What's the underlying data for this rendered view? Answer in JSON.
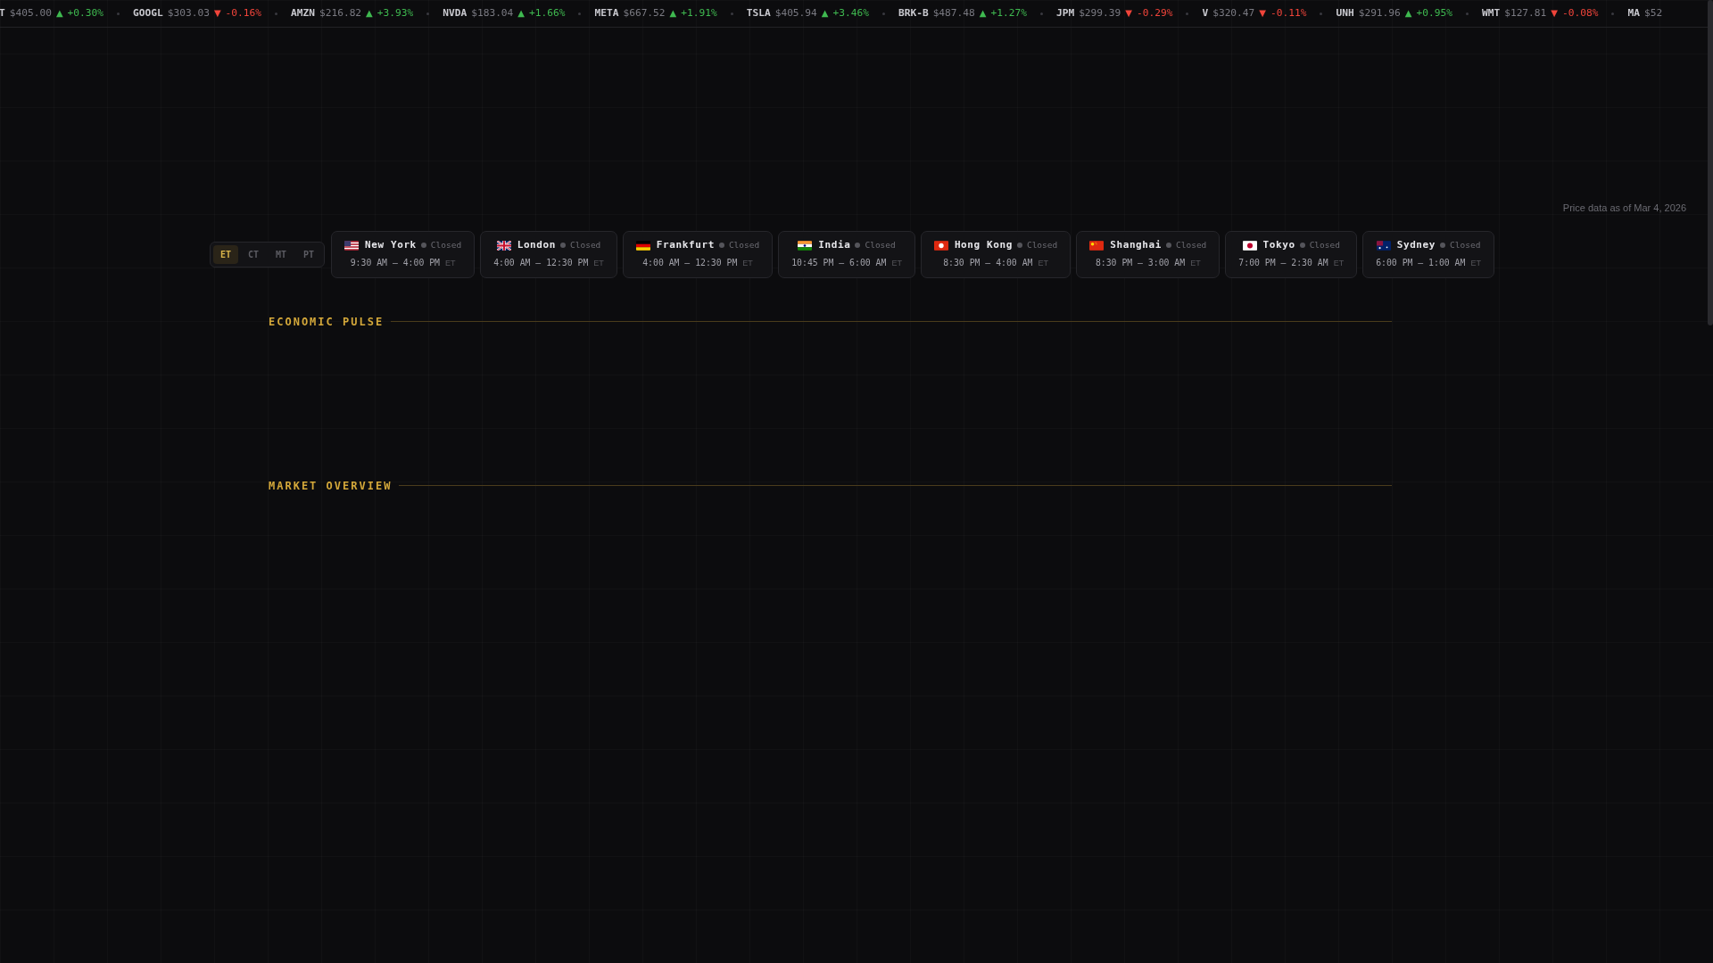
{
  "ticker": [
    {
      "symbol": "T",
      "price": "$405.00",
      "positive": true,
      "arrow": "▲",
      "change": "+0.30%"
    },
    {
      "symbol": "GOOGL",
      "price": "$303.03",
      "positive": false,
      "arrow": "▼",
      "change": "-0.16%"
    },
    {
      "symbol": "AMZN",
      "price": "$216.82",
      "positive": true,
      "arrow": "▲",
      "change": "+3.93%"
    },
    {
      "symbol": "NVDA",
      "price": "$183.04",
      "positive": true,
      "arrow": "▲",
      "change": "+1.66%"
    },
    {
      "symbol": "META",
      "price": "$667.52",
      "positive": true,
      "arrow": "▲",
      "change": "+1.91%"
    },
    {
      "symbol": "TSLA",
      "price": "$405.94",
      "positive": true,
      "arrow": "▲",
      "change": "+3.46%"
    },
    {
      "symbol": "BRK-B",
      "price": "$487.48",
      "positive": true,
      "arrow": "▲",
      "change": "+1.27%"
    },
    {
      "symbol": "JPM",
      "price": "$299.39",
      "positive": false,
      "arrow": "▼",
      "change": "-0.29%"
    },
    {
      "symbol": "V",
      "price": "$320.47",
      "positive": false,
      "arrow": "▼",
      "change": "-0.11%"
    },
    {
      "symbol": "UNH",
      "price": "$291.96",
      "positive": true,
      "arrow": "▲",
      "change": "+0.95%"
    },
    {
      "symbol": "WMT",
      "price": "$127.81",
      "positive": false,
      "arrow": "▼",
      "change": "-0.08%"
    },
    {
      "symbol": "MA",
      "price": "$52"
    }
  ],
  "price_note": "Price data as of Mar 4, 2026",
  "timezones": [
    {
      "label": "ET",
      "selected": true
    },
    {
      "label": "CT",
      "selected": false
    },
    {
      "label": "MT",
      "selected": false
    },
    {
      "label": "PT",
      "selected": false
    }
  ],
  "markets": [
    {
      "kind": "us",
      "name": "New York",
      "status": "Closed",
      "open": false,
      "hours": "9:30 AM – 4:00 PM",
      "tz": "ET"
    },
    {
      "kind": "gb",
      "name": "London",
      "status": "Closed",
      "open": false,
      "hours": "4:00 AM – 12:30 PM",
      "tz": "ET"
    },
    {
      "kind": "de",
      "name": "Frankfurt",
      "status": "Closed",
      "open": false,
      "hours": "4:00 AM – 12:30 PM",
      "tz": "ET"
    },
    {
      "kind": "in",
      "name": "India",
      "status": "Closed",
      "open": false,
      "hours": "10:45 PM – 6:00 AM",
      "tz": "ET"
    },
    {
      "kind": "hk",
      "name": "Hong Kong",
      "status": "Closed",
      "open": false,
      "hours": "8:30 PM – 4:00 AM",
      "tz": "ET"
    },
    {
      "kind": "cn",
      "name": "Shanghai",
      "status": "Closed",
      "open": false,
      "hours": "8:30 PM – 3:00 AM",
      "tz": "ET"
    },
    {
      "kind": "jp",
      "name": "Tokyo",
      "status": "Closed",
      "open": false,
      "hours": "7:00 PM – 2:30 AM",
      "tz": "ET"
    },
    {
      "kind": "au",
      "name": "Sydney",
      "status": "Closed",
      "open": false,
      "hours": "6:00 PM – 1:00 AM",
      "tz": "ET"
    }
  ],
  "sections": [
    {
      "title": "ECONOMIC PULSE"
    },
    {
      "title": "MARKET OVERVIEW"
    }
  ]
}
